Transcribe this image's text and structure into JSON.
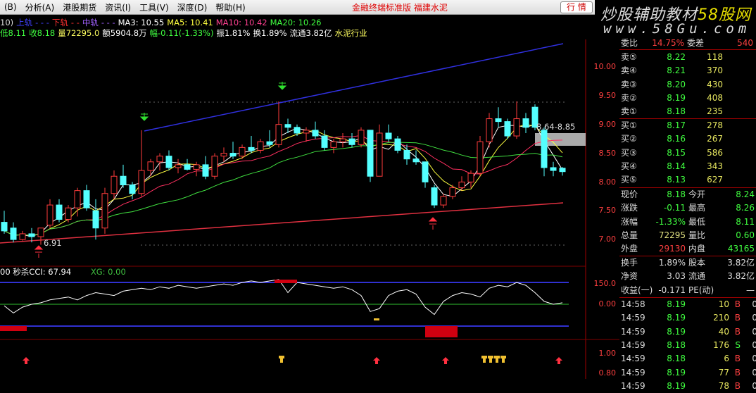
{
  "menu": {
    "items": [
      "(B)",
      "分析(A)",
      "港股期货",
      "资讯(I)",
      "工具(V)",
      "深度(D)",
      "帮助(H)"
    ],
    "title": "金融终端标准版  福建水泥",
    "button": "行  情"
  },
  "watermark": {
    "line1a": "炒股辅助教材",
    "line1b": "58股网",
    "line2": "www.58Gu.com"
  },
  "info1": [
    {
      "t": "10)",
      "c": "#ddd"
    },
    {
      "t": "上轨",
      "c": "#4040ff"
    },
    {
      "t": "- - -",
      "c": "#4040ff"
    },
    {
      "t": "下轨",
      "c": "#ff3030"
    },
    {
      "t": "- -",
      "c": "#ff3030"
    },
    {
      "t": "中轨",
      "c": "#a060ff"
    },
    {
      "t": "- - -",
      "c": "#a060ff"
    },
    {
      "t": "MA3: 10.55",
      "c": "#fff"
    },
    {
      "t": "MA5: 10.41",
      "c": "#ffff40"
    },
    {
      "t": "MA10: 10.42",
      "c": "#ff4090"
    },
    {
      "t": "MA20: 10.26",
      "c": "#40ff40"
    }
  ],
  "info2": [
    {
      "t": "低8.11",
      "c": "#40ff40"
    },
    {
      "t": "收8.18",
      "c": "#40ff40"
    },
    {
      "t": "量72295.0",
      "c": "#ffff60"
    },
    {
      "t": "额5904.8万",
      "c": "#fff"
    },
    {
      "t": "幅-0.11(-1.33%)",
      "c": "#40ff40"
    },
    {
      "t": "振1.81%",
      "c": "#fff"
    },
    {
      "t": "换1.89%",
      "c": "#fff"
    },
    {
      "t": "流通3.82亿",
      "c": "#fff"
    },
    {
      "t": "水泥行业",
      "c": "#ffff60"
    }
  ],
  "indicator": {
    "label": "00 秒杀CCI: 67.94",
    "xg": "XG: 0.00"
  },
  "price_axis": [
    "10.00",
    "9.50",
    "9.00",
    "8.50",
    "8.00",
    "7.50",
    "7.00"
  ],
  "cci_axis": [
    "150.0",
    "0.00"
  ],
  "vol_axis": [
    "1.00",
    "0.80"
  ],
  "annotations": {
    "low": "6.91",
    "range": "8.64-8.85"
  },
  "orderbook": {
    "header": {
      "l1": "委比",
      "v1": "14.75%",
      "l2": "委差",
      "v2": "540"
    },
    "asks": [
      {
        "l": "卖⑤",
        "p": "8.22",
        "v": "118"
      },
      {
        "l": "卖④",
        "p": "8.21",
        "v": "370"
      },
      {
        "l": "卖③",
        "p": "8.20",
        "v": "430"
      },
      {
        "l": "卖②",
        "p": "8.19",
        "v": "408"
      },
      {
        "l": "卖①",
        "p": "8.18",
        "v": "235"
      }
    ],
    "bids": [
      {
        "l": "买①",
        "p": "8.17",
        "v": "278"
      },
      {
        "l": "买②",
        "p": "8.16",
        "v": "267"
      },
      {
        "l": "买③",
        "p": "8.15",
        "v": "586"
      },
      {
        "l": "买④",
        "p": "8.14",
        "v": "343"
      },
      {
        "l": "买⑤",
        "p": "8.13",
        "v": "627"
      }
    ]
  },
  "quote": [
    {
      "l1": "现价",
      "v1": "8.18",
      "c1": "#40ff40",
      "l2": "今开",
      "v2": "8.24",
      "c2": "#40ff40"
    },
    {
      "l1": "涨跌",
      "v1": "-0.11",
      "c1": "#40ff40",
      "l2": "最高",
      "v2": "8.26",
      "c2": "#40ff40"
    },
    {
      "l1": "涨幅",
      "v1": "-1.33%",
      "c1": "#40ff40",
      "l2": "最低",
      "v2": "8.11",
      "c2": "#40ff40"
    },
    {
      "l1": "总量",
      "v1": "72295",
      "c1": "#e0e080",
      "l2": "量比",
      "v2": "0.60",
      "c2": "#40ff40"
    },
    {
      "l1": "外盘",
      "v1": "29130",
      "c1": "#ff4040",
      "l2": "内盘",
      "v2": "43165",
      "c2": "#40ff40"
    }
  ],
  "fund": [
    {
      "l1": "换手",
      "v1": "1.89%",
      "l2": "股本",
      "v2": "3.82亿"
    },
    {
      "l1": "净资",
      "v1": "3.03",
      "l2": "流通",
      "v2": "3.82亿"
    },
    {
      "l1": "收益(一)",
      "v1": "-0.171",
      "l2": "PE(动)",
      "v2": "—"
    }
  ],
  "ticks": [
    {
      "t": "14:58",
      "p": "8.19",
      "v": "10",
      "s": "B",
      "n": "0"
    },
    {
      "t": "14:59",
      "p": "8.19",
      "v": "210",
      "s": "B",
      "n": "0"
    },
    {
      "t": "14:59",
      "p": "8.19",
      "v": "40",
      "s": "B",
      "n": "0"
    },
    {
      "t": "14:59",
      "p": "8.18",
      "v": "176",
      "s": "S",
      "n": "0"
    },
    {
      "t": "14:59",
      "p": "8.18",
      "v": "6",
      "s": "B",
      "n": "0"
    },
    {
      "t": "14:59",
      "p": "8.19",
      "v": "77",
      "s": "B",
      "n": "0"
    },
    {
      "t": "14:59",
      "p": "8.19",
      "v": "78",
      "s": "B",
      "n": "0"
    }
  ],
  "chart_data": {
    "type": "candlestick",
    "ylim": [
      6.8,
      10.5
    ],
    "ohlc": [
      [
        7.3,
        7.5,
        7.1,
        7.15
      ],
      [
        7.2,
        7.3,
        6.95,
        7.0
      ],
      [
        7.0,
        7.15,
        6.98,
        7.1
      ],
      [
        7.1,
        7.2,
        6.95,
        7.05
      ],
      [
        7.05,
        7.15,
        6.91,
        7.2
      ],
      [
        7.25,
        7.7,
        7.2,
        7.6
      ],
      [
        7.6,
        7.7,
        7.3,
        7.35
      ],
      [
        7.35,
        7.6,
        7.3,
        7.55
      ],
      [
        7.55,
        7.9,
        7.4,
        7.85
      ],
      [
        7.85,
        7.95,
        7.5,
        7.55
      ],
      [
        7.5,
        7.7,
        7.0,
        7.2
      ],
      [
        7.2,
        7.9,
        7.1,
        7.8
      ],
      [
        7.8,
        8.2,
        7.7,
        8.1
      ],
      [
        8.1,
        8.3,
        7.9,
        7.95
      ],
      [
        7.95,
        8.0,
        7.7,
        7.8
      ],
      [
        7.8,
        8.9,
        7.75,
        8.2
      ],
      [
        8.2,
        8.4,
        8.1,
        8.35
      ],
      [
        8.35,
        8.5,
        8.2,
        8.45
      ],
      [
        8.45,
        8.55,
        8.2,
        8.25
      ],
      [
        8.25,
        8.4,
        8.15,
        8.3
      ],
      [
        8.3,
        8.4,
        8.2,
        8.22
      ],
      [
        8.22,
        8.35,
        8.1,
        8.3
      ],
      [
        8.3,
        8.45,
        8.05,
        8.1
      ],
      [
        8.1,
        8.5,
        8.05,
        8.45
      ],
      [
        8.45,
        8.6,
        8.35,
        8.5
      ],
      [
        8.5,
        8.7,
        8.4,
        8.45
      ],
      [
        8.45,
        8.65,
        8.4,
        8.6
      ],
      [
        8.6,
        8.8,
        8.5,
        8.55
      ],
      [
        8.55,
        8.75,
        8.5,
        8.7
      ],
      [
        8.7,
        8.9,
        8.6,
        8.65
      ],
      [
        8.65,
        9.4,
        8.6,
        9.0
      ],
      [
        9.0,
        9.1,
        8.85,
        8.95
      ],
      [
        8.95,
        9.0,
        8.8,
        8.85
      ],
      [
        8.85,
        8.95,
        8.7,
        8.9
      ],
      [
        8.9,
        9.05,
        8.75,
        8.8
      ],
      [
        8.8,
        8.9,
        8.55,
        8.6
      ],
      [
        8.6,
        8.75,
        8.5,
        8.7
      ],
      [
        8.7,
        8.85,
        8.6,
        8.75
      ],
      [
        8.75,
        8.85,
        8.6,
        8.65
      ],
      [
        8.65,
        8.95,
        8.6,
        8.9
      ],
      [
        8.9,
        8.9,
        8.0,
        8.1
      ],
      [
        8.1,
        9.0,
        8.1,
        8.85
      ],
      [
        8.85,
        9.0,
        8.7,
        8.75
      ],
      [
        8.75,
        8.8,
        8.5,
        8.55
      ],
      [
        8.55,
        8.65,
        8.3,
        8.4
      ],
      [
        8.4,
        8.55,
        8.3,
        8.35
      ],
      [
        8.35,
        8.35,
        7.9,
        8.0
      ],
      [
        7.9,
        7.95,
        7.55,
        7.6
      ],
      [
        7.6,
        7.8,
        7.55,
        7.75
      ],
      [
        7.75,
        7.95,
        7.7,
        7.9
      ],
      [
        7.9,
        8.1,
        7.85,
        8.0
      ],
      [
        8.0,
        8.2,
        7.9,
        8.15
      ],
      [
        8.15,
        8.8,
        8.1,
        8.7
      ],
      [
        8.7,
        9.2,
        8.6,
        9.1
      ],
      [
        9.1,
        9.3,
        8.95,
        9.05
      ],
      [
        9.05,
        9.1,
        8.75,
        8.8
      ],
      [
        8.8,
        9.4,
        8.75,
        9.1
      ],
      [
        9.1,
        9.2,
        8.85,
        8.95
      ],
      [
        9.3,
        9.35,
        8.9,
        8.95
      ],
      [
        8.9,
        8.95,
        8.1,
        8.25
      ],
      [
        8.25,
        8.35,
        8.1,
        8.2
      ],
      [
        8.24,
        8.26,
        8.11,
        8.18
      ]
    ],
    "ma_periods": [
      3,
      5,
      10,
      20
    ],
    "ma_colors": [
      "#ffffff",
      "#ffff40",
      "#ff3060",
      "#40e040"
    ],
    "cci": [
      -10,
      -60,
      -20,
      0,
      10,
      30,
      40,
      50,
      30,
      60,
      80,
      70,
      60,
      90,
      100,
      110,
      100,
      120,
      110,
      130,
      120,
      110,
      120,
      130,
      140,
      130,
      150,
      160,
      150,
      160,
      170,
      80,
      150,
      140,
      130,
      120,
      110,
      120,
      100,
      60,
      -50,
      -30,
      60,
      90,
      100,
      70,
      -20,
      -70,
      20,
      60,
      80,
      70,
      50,
      110,
      130,
      120,
      150,
      130,
      80,
      20,
      0,
      10
    ],
    "up_color": "#ff3c3c",
    "down_color": "#54ffff"
  }
}
